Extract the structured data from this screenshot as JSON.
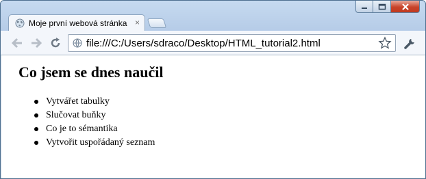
{
  "browser": {
    "tab": {
      "title": "Moje první webová stránka",
      "close_glyph": "×",
      "favicon": "globe-icon"
    },
    "address_bar": {
      "url": "file:///C:/Users/sdraco/Desktop/HTML_tutorial2.html",
      "page_icon": "globe-icon"
    },
    "icons": [
      "back-icon",
      "forward-icon",
      "reload-icon",
      "star-icon",
      "wrench-icon"
    ]
  },
  "page": {
    "heading": "Co jsem se dnes naučil",
    "list": [
      "Vytvářet tabulky",
      "Slučovat buňky",
      "Co je to sémantika",
      "Vytvořit uspořádaný seznam"
    ]
  }
}
